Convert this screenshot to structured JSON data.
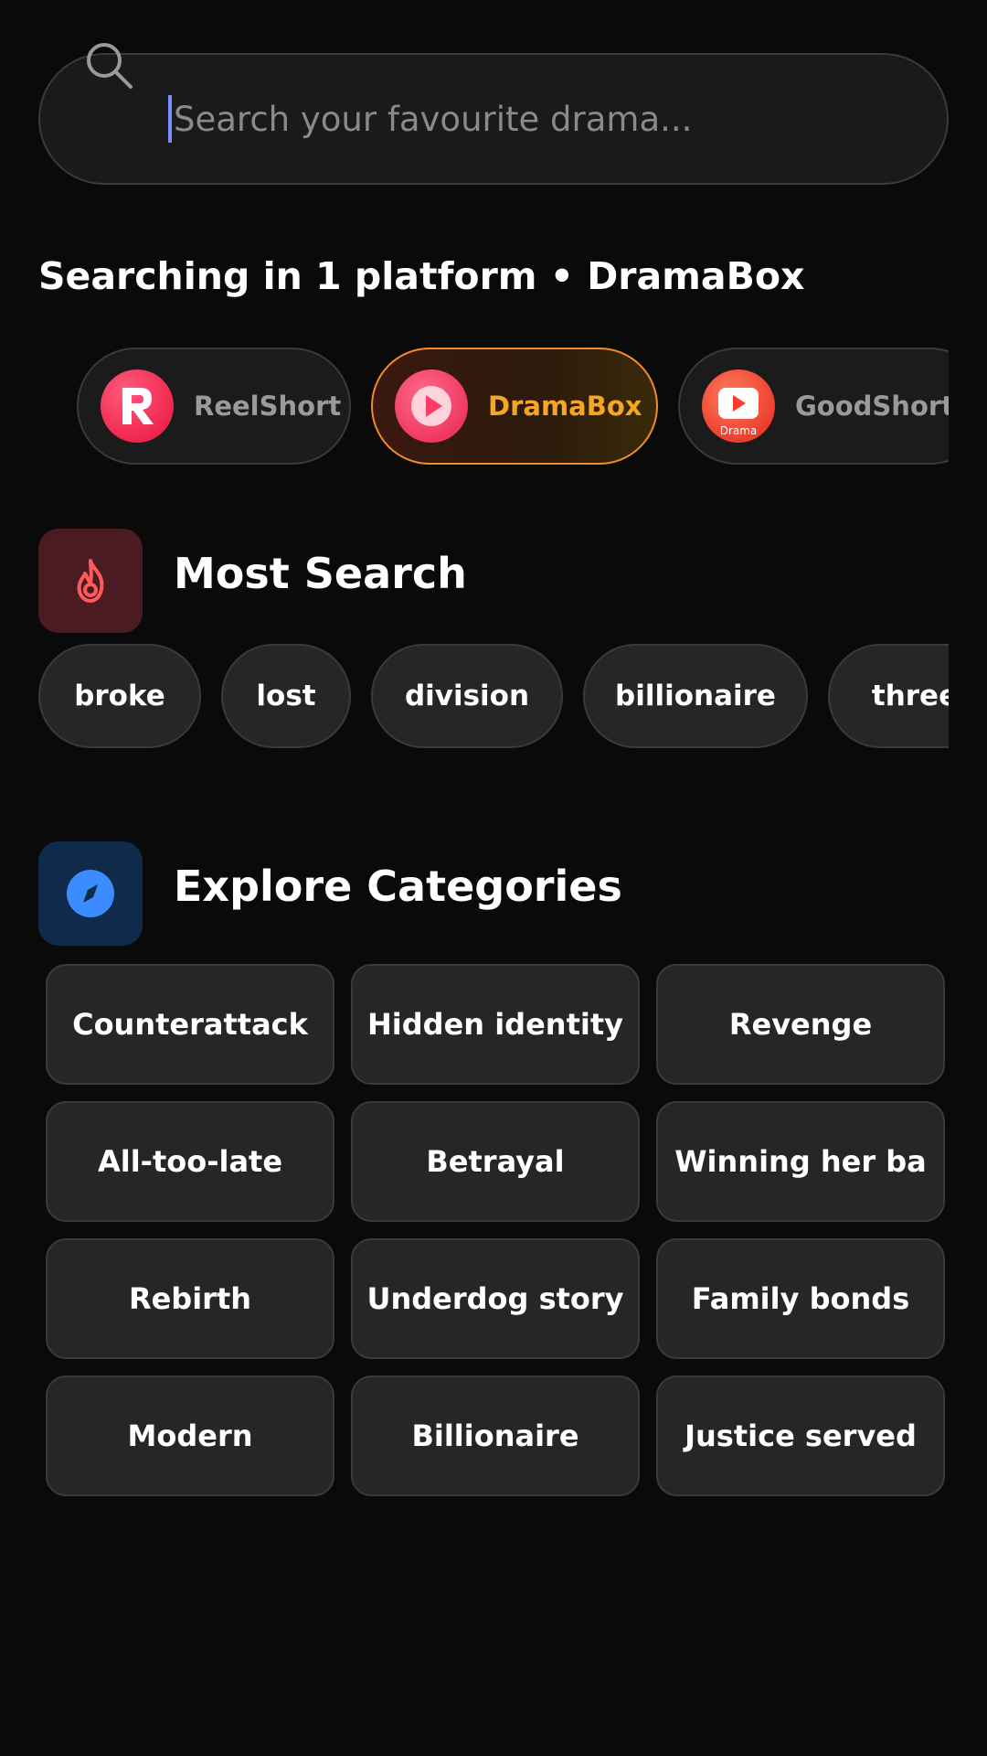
{
  "search": {
    "placeholder": "Search your favourite drama..."
  },
  "platform_status": "Searching in 1 platform • DramaBox",
  "platforms": [
    {
      "label": "ReelShort",
      "active": false,
      "logo_color": "#ff2d55"
    },
    {
      "label": "DramaBox",
      "active": true,
      "logo_color": "#ff3b6b"
    },
    {
      "label": "GoodShort",
      "active": false,
      "logo_color": "#ff3b30",
      "logo_text": "Drama"
    }
  ],
  "most_search": {
    "title": "Most Search",
    "icon": "flame-icon",
    "icon_bg": "#4a1c22",
    "icon_color": "#ff5a5a",
    "tags": [
      "broke",
      "lost",
      "division",
      "billionaire",
      "three"
    ]
  },
  "explore": {
    "title": "Explore Categories",
    "icon": "compass-icon",
    "icon_bg": "#0f2a4a",
    "icon_color": "#3b8cff",
    "categories": [
      "Counterattack",
      "Hidden identity",
      "Revenge",
      "All-too-late",
      "Betrayal",
      "Winning her ba",
      "Rebirth",
      "Underdog story",
      "Family bonds",
      "Modern",
      "Billionaire",
      "Justice served"
    ]
  },
  "colors": {
    "accent": "#f28c28",
    "active_label": "#f5a623"
  }
}
